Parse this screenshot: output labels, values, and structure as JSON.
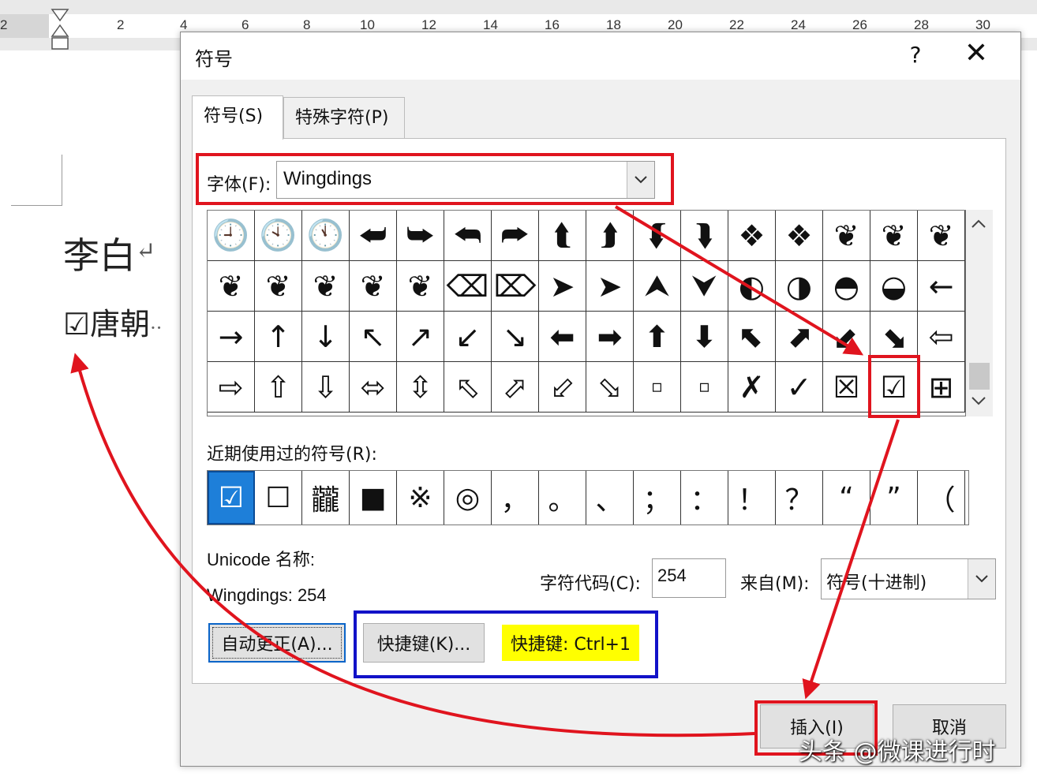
{
  "ruler": {
    "labels": [
      "2",
      "2",
      "4",
      "6",
      "8",
      "10",
      "12",
      "14",
      "16",
      "18",
      "20",
      "22",
      "24",
      "26",
      "28",
      "30"
    ]
  },
  "document": {
    "line1": "李白",
    "line1_mark": "↵",
    "line2_box": "☑",
    "line2_text": "唐朝",
    "line2_dots": "··"
  },
  "dialog": {
    "title": "符号",
    "help": "?",
    "close": "✕",
    "tabs": [
      {
        "label": "符号(S)"
      },
      {
        "label": "特殊字符(P)"
      }
    ],
    "font_label": "字体(F):",
    "font_value": "Wingdings",
    "grid": [
      "🕘",
      "🕙",
      "🕚",
      "⮨",
      "⮩",
      "⮪",
      "⮫",
      "⮬",
      "⮭",
      "⮮",
      "⮯",
      "❖",
      "❖",
      "❦",
      "❦",
      "❦",
      "❦",
      "❦",
      "❦",
      "❦",
      "❦",
      "⌫",
      "⌦",
      "➤",
      "➤",
      "⮝",
      "⮟",
      "◐",
      "◑",
      "◓",
      "◒",
      "←",
      "→",
      "↑",
      "↓",
      "↖",
      "↗",
      "↙",
      "↘",
      "⬅",
      "➡",
      "⬆",
      "⬇",
      "⬉",
      "⬈",
      "⬋",
      "⬊",
      "⇦",
      "⇨",
      "⇧",
      "⇩",
      "⬄",
      "⇳",
      "⬁",
      "⬀",
      "⬃",
      "⬂",
      "▫",
      "▫",
      "✗",
      "✓",
      "☒",
      "☑",
      "⊞"
    ],
    "recent_label": "近期使用过的符号(R):",
    "recent": [
      "☑",
      "☐",
      "龖",
      "■",
      "※",
      "◎",
      "，",
      "。",
      "、",
      "；",
      "：",
      "！",
      "？",
      "“",
      "”",
      "（"
    ],
    "unicode_name_label": "Unicode 名称:",
    "unicode_name_value": "Wingdings: 254",
    "char_code_label": "字符代码(C):",
    "char_code_value": "254",
    "from_label": "来自(M):",
    "from_value": "符号(十进制)",
    "autocorrect_label": "自动更正(A)...",
    "shortcut_button_label": "快捷键(K)...",
    "shortcut_text": "快捷键: Ctrl+1",
    "insert_label": "插入(I)",
    "cancel_label": "取消"
  },
  "watermark": "头条 @微课进行时",
  "colors": {
    "annotation_red": "#e0141e",
    "annotation_blue": "#1212c8",
    "highlight_yellow": "#ffff00",
    "selected_blue": "#1e7fd9"
  }
}
